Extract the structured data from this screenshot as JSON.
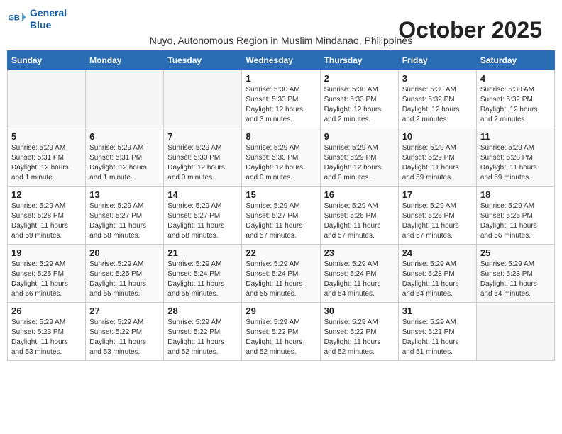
{
  "logo": {
    "line1": "General",
    "line2": "Blue"
  },
  "title": "October 2025",
  "subtitle": "Nuyo, Autonomous Region in Muslim Mindanao, Philippines",
  "weekdays": [
    "Sunday",
    "Monday",
    "Tuesday",
    "Wednesday",
    "Thursday",
    "Friday",
    "Saturday"
  ],
  "weeks": [
    [
      {
        "day": "",
        "info": ""
      },
      {
        "day": "",
        "info": ""
      },
      {
        "day": "",
        "info": ""
      },
      {
        "day": "1",
        "info": "Sunrise: 5:30 AM\nSunset: 5:33 PM\nDaylight: 12 hours and 3 minutes."
      },
      {
        "day": "2",
        "info": "Sunrise: 5:30 AM\nSunset: 5:33 PM\nDaylight: 12 hours and 2 minutes."
      },
      {
        "day": "3",
        "info": "Sunrise: 5:30 AM\nSunset: 5:32 PM\nDaylight: 12 hours and 2 minutes."
      },
      {
        "day": "4",
        "info": "Sunrise: 5:30 AM\nSunset: 5:32 PM\nDaylight: 12 hours and 2 minutes."
      }
    ],
    [
      {
        "day": "5",
        "info": "Sunrise: 5:29 AM\nSunset: 5:31 PM\nDaylight: 12 hours and 1 minute."
      },
      {
        "day": "6",
        "info": "Sunrise: 5:29 AM\nSunset: 5:31 PM\nDaylight: 12 hours and 1 minute."
      },
      {
        "day": "7",
        "info": "Sunrise: 5:29 AM\nSunset: 5:30 PM\nDaylight: 12 hours and 0 minutes."
      },
      {
        "day": "8",
        "info": "Sunrise: 5:29 AM\nSunset: 5:30 PM\nDaylight: 12 hours and 0 minutes."
      },
      {
        "day": "9",
        "info": "Sunrise: 5:29 AM\nSunset: 5:29 PM\nDaylight: 12 hours and 0 minutes."
      },
      {
        "day": "10",
        "info": "Sunrise: 5:29 AM\nSunset: 5:29 PM\nDaylight: 11 hours and 59 minutes."
      },
      {
        "day": "11",
        "info": "Sunrise: 5:29 AM\nSunset: 5:28 PM\nDaylight: 11 hours and 59 minutes."
      }
    ],
    [
      {
        "day": "12",
        "info": "Sunrise: 5:29 AM\nSunset: 5:28 PM\nDaylight: 11 hours and 59 minutes."
      },
      {
        "day": "13",
        "info": "Sunrise: 5:29 AM\nSunset: 5:27 PM\nDaylight: 11 hours and 58 minutes."
      },
      {
        "day": "14",
        "info": "Sunrise: 5:29 AM\nSunset: 5:27 PM\nDaylight: 11 hours and 58 minutes."
      },
      {
        "day": "15",
        "info": "Sunrise: 5:29 AM\nSunset: 5:27 PM\nDaylight: 11 hours and 57 minutes."
      },
      {
        "day": "16",
        "info": "Sunrise: 5:29 AM\nSunset: 5:26 PM\nDaylight: 11 hours and 57 minutes."
      },
      {
        "day": "17",
        "info": "Sunrise: 5:29 AM\nSunset: 5:26 PM\nDaylight: 11 hours and 57 minutes."
      },
      {
        "day": "18",
        "info": "Sunrise: 5:29 AM\nSunset: 5:25 PM\nDaylight: 11 hours and 56 minutes."
      }
    ],
    [
      {
        "day": "19",
        "info": "Sunrise: 5:29 AM\nSunset: 5:25 PM\nDaylight: 11 hours and 56 minutes."
      },
      {
        "day": "20",
        "info": "Sunrise: 5:29 AM\nSunset: 5:25 PM\nDaylight: 11 hours and 55 minutes."
      },
      {
        "day": "21",
        "info": "Sunrise: 5:29 AM\nSunset: 5:24 PM\nDaylight: 11 hours and 55 minutes."
      },
      {
        "day": "22",
        "info": "Sunrise: 5:29 AM\nSunset: 5:24 PM\nDaylight: 11 hours and 55 minutes."
      },
      {
        "day": "23",
        "info": "Sunrise: 5:29 AM\nSunset: 5:24 PM\nDaylight: 11 hours and 54 minutes."
      },
      {
        "day": "24",
        "info": "Sunrise: 5:29 AM\nSunset: 5:23 PM\nDaylight: 11 hours and 54 minutes."
      },
      {
        "day": "25",
        "info": "Sunrise: 5:29 AM\nSunset: 5:23 PM\nDaylight: 11 hours and 54 minutes."
      }
    ],
    [
      {
        "day": "26",
        "info": "Sunrise: 5:29 AM\nSunset: 5:23 PM\nDaylight: 11 hours and 53 minutes."
      },
      {
        "day": "27",
        "info": "Sunrise: 5:29 AM\nSunset: 5:22 PM\nDaylight: 11 hours and 53 minutes."
      },
      {
        "day": "28",
        "info": "Sunrise: 5:29 AM\nSunset: 5:22 PM\nDaylight: 11 hours and 52 minutes."
      },
      {
        "day": "29",
        "info": "Sunrise: 5:29 AM\nSunset: 5:22 PM\nDaylight: 11 hours and 52 minutes."
      },
      {
        "day": "30",
        "info": "Sunrise: 5:29 AM\nSunset: 5:22 PM\nDaylight: 11 hours and 52 minutes."
      },
      {
        "day": "31",
        "info": "Sunrise: 5:29 AM\nSunset: 5:21 PM\nDaylight: 11 hours and 51 minutes."
      },
      {
        "day": "",
        "info": ""
      }
    ]
  ]
}
